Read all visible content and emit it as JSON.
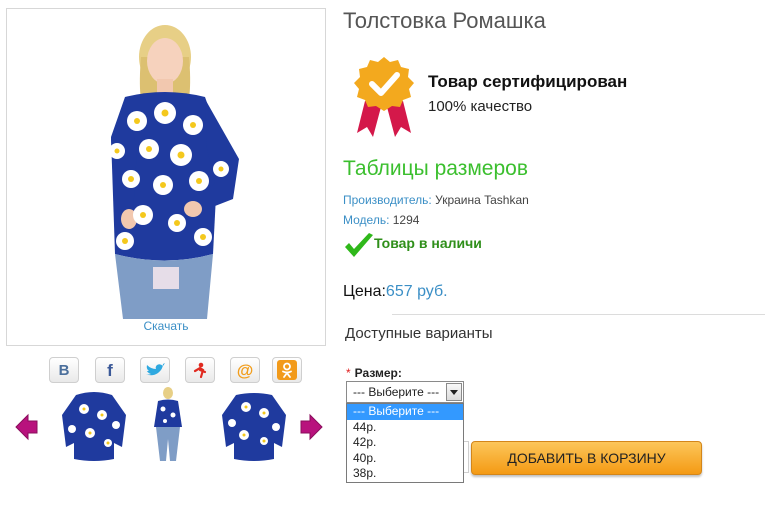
{
  "product": {
    "title": "Толстовка Ромашка",
    "download_label": "Скачать"
  },
  "certificate": {
    "title": "Товар сертифицирован",
    "subtitle": "100% качество"
  },
  "size_tables_link": "Таблицы размеров",
  "manufacturer": {
    "label": "Производитель:",
    "value": "Украина Tashkan"
  },
  "model": {
    "label": "Модель:",
    "value": "1294"
  },
  "stock_status": "Товар в наличи",
  "price": {
    "label": "Цена:",
    "value": "657 руб."
  },
  "variants_heading": "Доступные варианты",
  "size_field": {
    "required_mark": "*",
    "label": "Размер:",
    "selected": "--- Выберите ---",
    "options": [
      "--- Выберите ---",
      "44р.",
      "42р.",
      "40р.",
      "38р."
    ]
  },
  "add_to_cart_label": "ДОБАВИТЬ В КОРЗИНУ",
  "social_icons": [
    "vk-icon",
    "facebook-icon",
    "twitter-icon",
    "moimir-icon",
    "mailru-icon",
    "odnoklassniki-icon"
  ],
  "colors": {
    "link_blue": "#3b8fc6",
    "size_tables_green": "#3bbf2e",
    "stock_green": "#2f8f1a",
    "cart_orange": "#f49a14",
    "dropdown_highlight": "#3399ff",
    "sweater_blue": "#1f3a9e"
  }
}
